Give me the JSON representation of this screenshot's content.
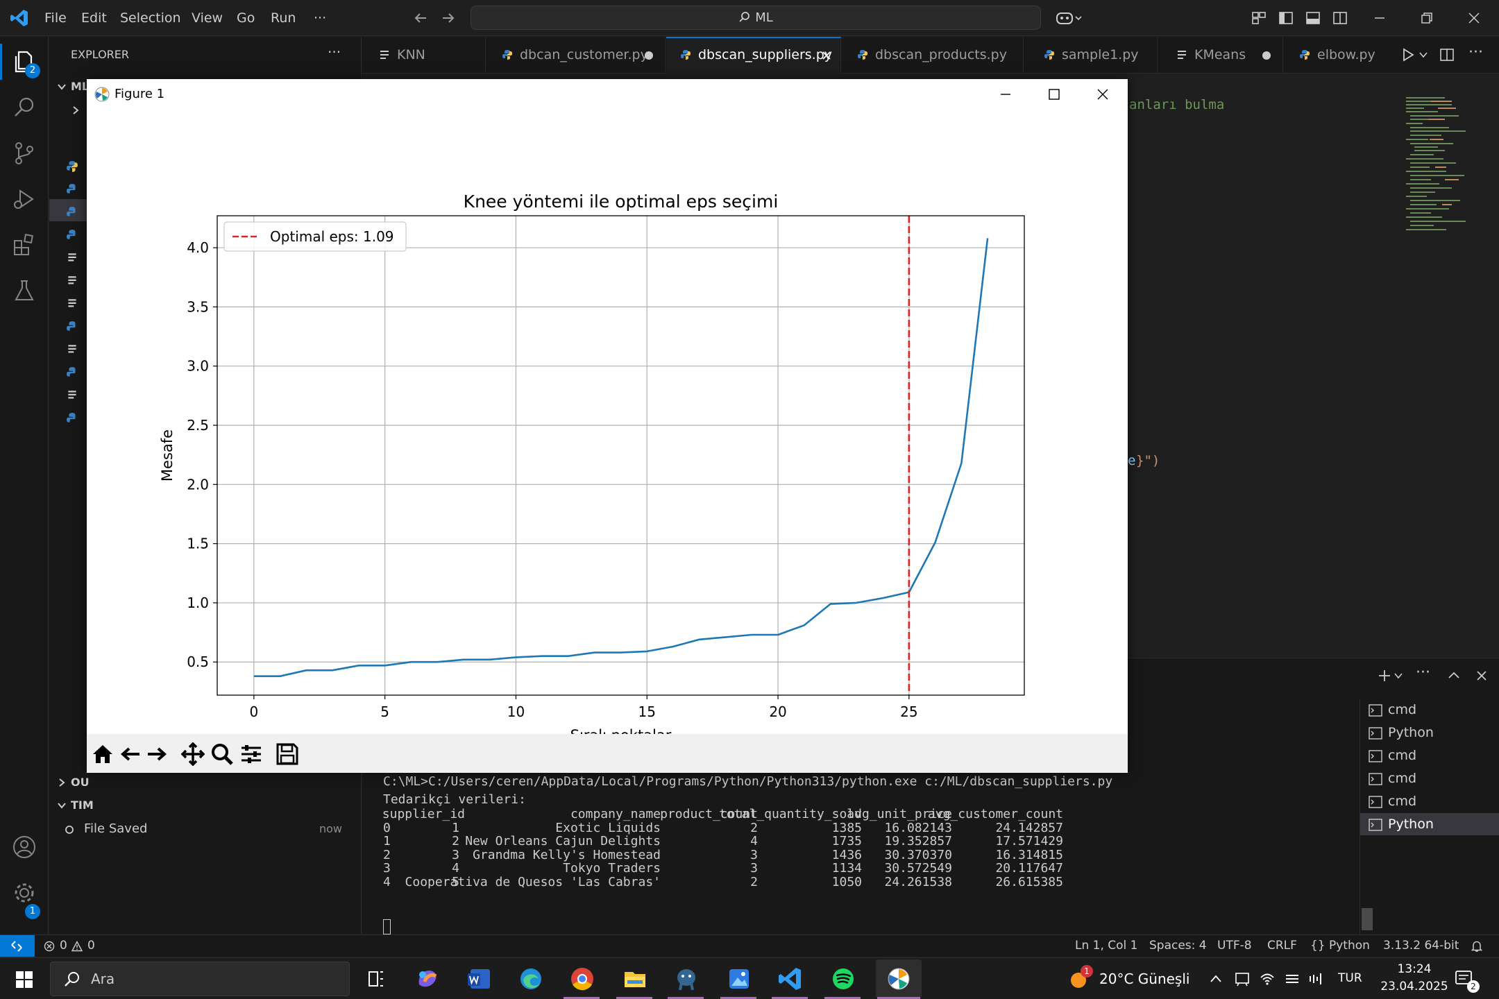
{
  "titlebar": {
    "menu": [
      "File",
      "Edit",
      "Selection",
      "View",
      "Go",
      "Run",
      "···"
    ],
    "search": "ML"
  },
  "activity": {
    "explorer_badge": "2",
    "settings_badge": "1"
  },
  "sidebar": {
    "title": "EXPLORER",
    "section_ml": "ML",
    "section_outline": "OU",
    "section_timeline": "TIM",
    "timeline_item": "File Saved",
    "timeline_time": "now"
  },
  "tabs": [
    {
      "label": "KNN",
      "icon": "notebook-icon"
    },
    {
      "label": "dbcan_customer.py",
      "icon": "python-icon",
      "dirty": true
    },
    {
      "label": "dbscan_suppliers.py",
      "icon": "python-icon",
      "active": true
    },
    {
      "label": "dbscan_products.py",
      "icon": "python-icon"
    },
    {
      "label": "sample1.py",
      "icon": "python-icon"
    },
    {
      "label": "KMeans",
      "icon": "notebook-icon",
      "dirty": true
    },
    {
      "label": "elbow.py",
      "icon": "python-icon"
    }
  ],
  "editor": {
    "comment_fragment": "anları bulma",
    "code_fragment_1": "e",
    "code_fragment_2": "}\")"
  },
  "figure": {
    "window_title": "Figure 1"
  },
  "chart_data": {
    "type": "line",
    "title": "Knee yöntemi ile optimal eps seçimi",
    "xlabel": "Sıralı noktalar",
    "ylabel": "Mesafe",
    "xlim": [
      -1.4,
      29.4
    ],
    "ylim": [
      0.22,
      4.27
    ],
    "xticks": [
      0,
      5,
      10,
      15,
      20,
      25
    ],
    "yticks": [
      0.5,
      1.0,
      1.5,
      2.0,
      2.5,
      3.0,
      3.5,
      4.0
    ],
    "grid": true,
    "legend_position": "upper-left",
    "series": [
      {
        "color": "#1f77b4",
        "x": [
          0,
          1,
          2,
          3,
          4,
          5,
          6,
          7,
          8,
          9,
          10,
          11,
          12,
          13,
          14,
          15,
          16,
          17,
          18,
          19,
          20,
          21,
          22,
          23,
          24,
          25,
          26,
          27,
          28
        ],
        "values": [
          0.38,
          0.38,
          0.43,
          0.43,
          0.47,
          0.47,
          0.5,
          0.5,
          0.52,
          0.52,
          0.54,
          0.55,
          0.55,
          0.58,
          0.58,
          0.59,
          0.63,
          0.69,
          0.71,
          0.73,
          0.73,
          0.81,
          0.99,
          1.0,
          1.04,
          1.09,
          1.51,
          2.18,
          4.08
        ]
      }
    ],
    "vline": {
      "x": 25,
      "color": "#d62728",
      "label": "Optimal eps: 1.09"
    }
  },
  "panel": {
    "terminals": [
      "cmd",
      "Python",
      "cmd",
      "cmd",
      "cmd",
      "Python"
    ],
    "command": "C:\\ML>C:/Users/ceren/AppData/Local/Programs/Python/Python313/python.exe c:/ML/dbscan_suppliers.py",
    "heading": "Tedarikçi verileri:",
    "columns": [
      "supplier_id",
      "company_name",
      "product_count",
      "total_quantity_sold",
      "avg_unit_price",
      "avg_customer_count"
    ],
    "rows": [
      [
        "0",
        "1",
        "Exotic Liquids",
        "2",
        "1385",
        "16.082143",
        "24.142857"
      ],
      [
        "1",
        "2",
        "New Orleans Cajun Delights",
        "4",
        "1735",
        "19.352857",
        "17.571429"
      ],
      [
        "2",
        "3",
        "Grandma Kelly's Homestead",
        "3",
        "1436",
        "30.370370",
        "16.314815"
      ],
      [
        "3",
        "4",
        "Tokyo Traders",
        "3",
        "1134",
        "30.572549",
        "20.117647"
      ],
      [
        "4",
        "5",
        "Cooperativa de Quesos 'Las Cabras'",
        "2",
        "1050",
        "24.261538",
        "26.615385"
      ]
    ]
  },
  "status": {
    "errors": "0",
    "warnings": "0",
    "position": "Ln 1, Col 1",
    "spaces": "Spaces: 4",
    "encoding": "UTF-8",
    "eol": "CRLF",
    "language": "Python",
    "interpreter": "3.13.2 64-bit"
  },
  "taskbar": {
    "search": "Ara",
    "weather": "20°C  Güneşli",
    "weather_badge": "1",
    "lang": "TUR",
    "time": "13:24",
    "date": "23.04.2025",
    "notif": "2"
  }
}
